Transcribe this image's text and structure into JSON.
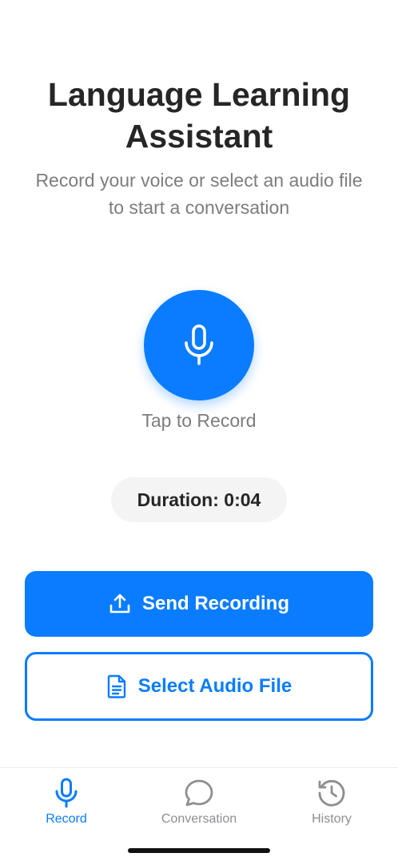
{
  "header": {
    "title": "Language Learning Assistant",
    "subtitle": "Record your voice or select an audio file to start a conversation"
  },
  "recorder": {
    "mic_icon": "microphone-icon",
    "tap_label": "Tap to Record",
    "duration_label": "Duration:",
    "duration_value": "0:04"
  },
  "actions": {
    "send_label": "Send Recording",
    "send_icon": "upload-icon",
    "select_label": "Select Audio File",
    "select_icon": "document-icon"
  },
  "tabbar": {
    "active_index": 0,
    "items": [
      {
        "label": "Record",
        "icon": "microphone-icon"
      },
      {
        "label": "Conversation",
        "icon": "chat-bubble-icon"
      },
      {
        "label": "History",
        "icon": "history-clock-icon"
      }
    ]
  },
  "colors": {
    "accent": "#0a7cff",
    "title": "#262626",
    "muted": "#7d7d7d",
    "tab_inactive": "#8e8e93",
    "pill_background": "#f3f4f3"
  }
}
